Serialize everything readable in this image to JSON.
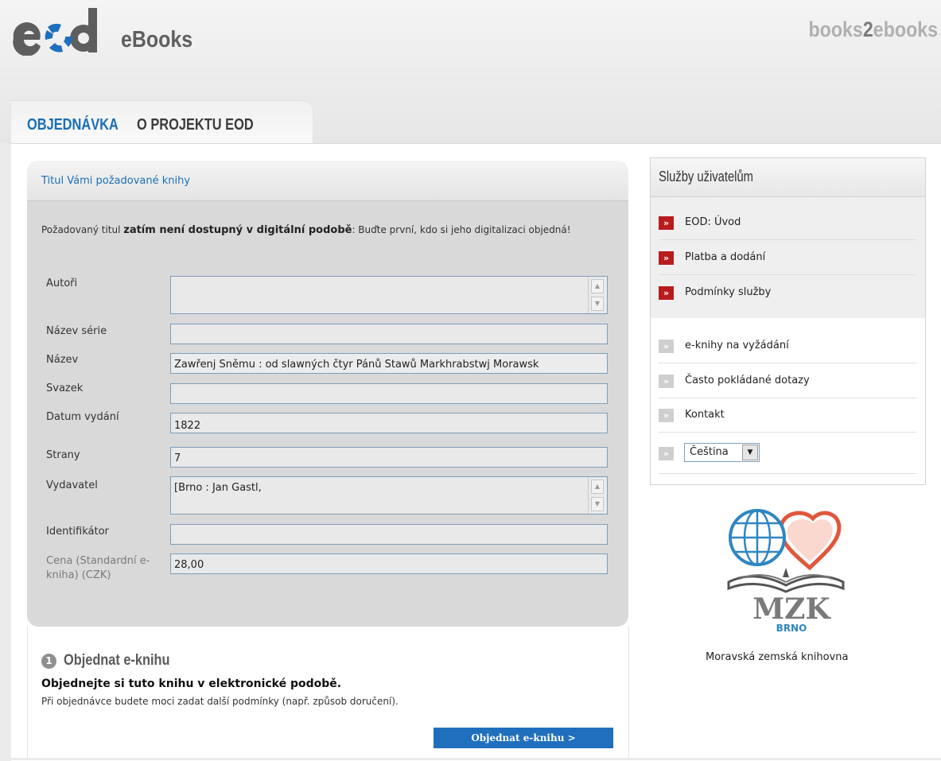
{
  "header": {
    "logo_text": "eod",
    "logo_suffix": "eBooks",
    "brand_right_a": "books",
    "brand_right_b": "2",
    "brand_right_c": "ebooks"
  },
  "tabs": [
    {
      "label": "OBJEDNÁVKA",
      "active": true
    },
    {
      "label": "O PROJEKTU EOD",
      "active": false
    }
  ],
  "form": {
    "title": "Titul Vámi požadované knihy",
    "notice_prefix": "Požadovaný titul ",
    "notice_bold": "zatím není dostupný v digitální podobě",
    "notice_suffix": ": Buďte první, kdo si jeho digitalizaci objedná!",
    "fields": [
      {
        "label": "Autoři",
        "value": ""
      },
      {
        "label": "Název série",
        "value": ""
      },
      {
        "label": "Název",
        "value": "Zawřenj Sněmu : od slawných čtyr Pánů Stawů Markhrabstwj Morawsk"
      },
      {
        "label": "Svazek",
        "value": ""
      },
      {
        "label": "Datum vydání",
        "value": "1822"
      },
      {
        "label": "Strany",
        "value": "7"
      },
      {
        "label": "Vydavatel",
        "value": "[Brno : Jan Gastl,"
      },
      {
        "label": "Identifikátor",
        "value": ""
      },
      {
        "label": "Cena (Standardní e-kniha) (CZK)",
        "value": "28,00"
      }
    ]
  },
  "step": {
    "number": "1",
    "title": "Objednat e-knihu",
    "lead": "Objednejte si tuto knihu v elektronické podobě.",
    "description": "Při objednávce budete moci zadat další podmínky (např. způsob doručení).",
    "button_label": "Objednat e-knihu >"
  },
  "sidebar": {
    "title": "Služby uživatelům",
    "primary_items": [
      {
        "label": "EOD: Úvod"
      },
      {
        "label": "Platba a dodání"
      },
      {
        "label": "Podmínky služby"
      }
    ],
    "secondary_items": [
      {
        "label": "e-knihy na vyžádání"
      },
      {
        "label": "Často pokládané dotazy"
      },
      {
        "label": "Kontakt"
      }
    ],
    "language_selected": "Čeština",
    "library_logo_text": "MZK",
    "library_logo_subtext": "BRNO",
    "library_name": "Moravská zemská knihovna"
  },
  "colors": {
    "accent_blue": "#1a6eb5",
    "button_blue": "#1f6fbd",
    "bullet_red": "#b81c1c",
    "panel_gray": "#d9d9d9"
  },
  "icons": {
    "bullet": "double-chevron-right-icon",
    "dropdown": "triangle-down-icon",
    "scroll_up": "triangle-up-icon",
    "scroll_down": "triangle-down-icon"
  }
}
